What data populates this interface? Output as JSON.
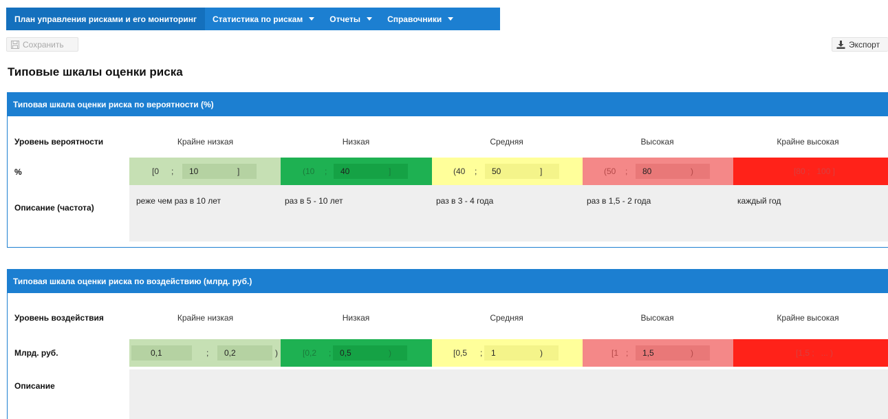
{
  "nav": {
    "items": [
      {
        "label": "План управления рисками и его мониторинг",
        "dropdown": false
      },
      {
        "label": "Статистика по рискам",
        "dropdown": true
      },
      {
        "label": "Отчеты",
        "dropdown": true
      },
      {
        "label": "Справочники",
        "dropdown": true
      }
    ]
  },
  "toolbar": {
    "save_label": "Сохранить",
    "export_label": "Экспорт"
  },
  "page_title": "Типовые шкалы оценки риска",
  "levels": [
    "Крайне низкая",
    "Низкая",
    "Средняя",
    "Высокая",
    "Крайне высокая"
  ],
  "colors": {
    "accent": "#1c7fd1",
    "extremely_low": "#c6e0b4",
    "low": "#1eb152",
    "medium": "#ffff9a",
    "high": "#f48888",
    "extremely_high": "#ff2219"
  },
  "probability": {
    "title": "Типовая шкала оценки риска по вероятности (%)",
    "level_label": "Уровень вероятности",
    "unit_label": "%",
    "desc_label": "Описание (частота)",
    "cells": [
      {
        "open": "[0",
        "sep": ";",
        "value": "10",
        "close": "]"
      },
      {
        "open": "(10",
        "sep": ";",
        "value": "40",
        "close": "]"
      },
      {
        "open": "(40",
        "sep": ";",
        "value": "50",
        "close": "]"
      },
      {
        "open": "(50",
        "sep": ";",
        "value": "80",
        "close": ")"
      },
      {
        "text": "[80 ;   100 ]"
      }
    ],
    "descriptions": [
      "реже чем раз в 10 лет",
      "раз в 5 - 10 лет",
      "раз в 3 - 4 года",
      "раз в 1,5 - 2 года",
      "каждый год"
    ]
  },
  "impact": {
    "title": "Типовая шкала оценки риска по воздействию (млрд. руб.)",
    "level_label": "Уровень воздействия",
    "unit_label": "Млрд. руб.",
    "desc_label": "Описание",
    "cells": [
      {
        "first": "0,1",
        "sep": ";",
        "value": "0,2",
        "close": ")"
      },
      {
        "open": "[0,2",
        "sep": ";",
        "value": "0,5",
        "close": ")"
      },
      {
        "open": "[0,5",
        "sep": ";",
        "value": "1",
        "close": ")"
      },
      {
        "open": "[1",
        "sep": ";",
        "value": "1,5",
        "close": ")"
      },
      {
        "text": "[1,5 ;   ... )"
      }
    ]
  }
}
